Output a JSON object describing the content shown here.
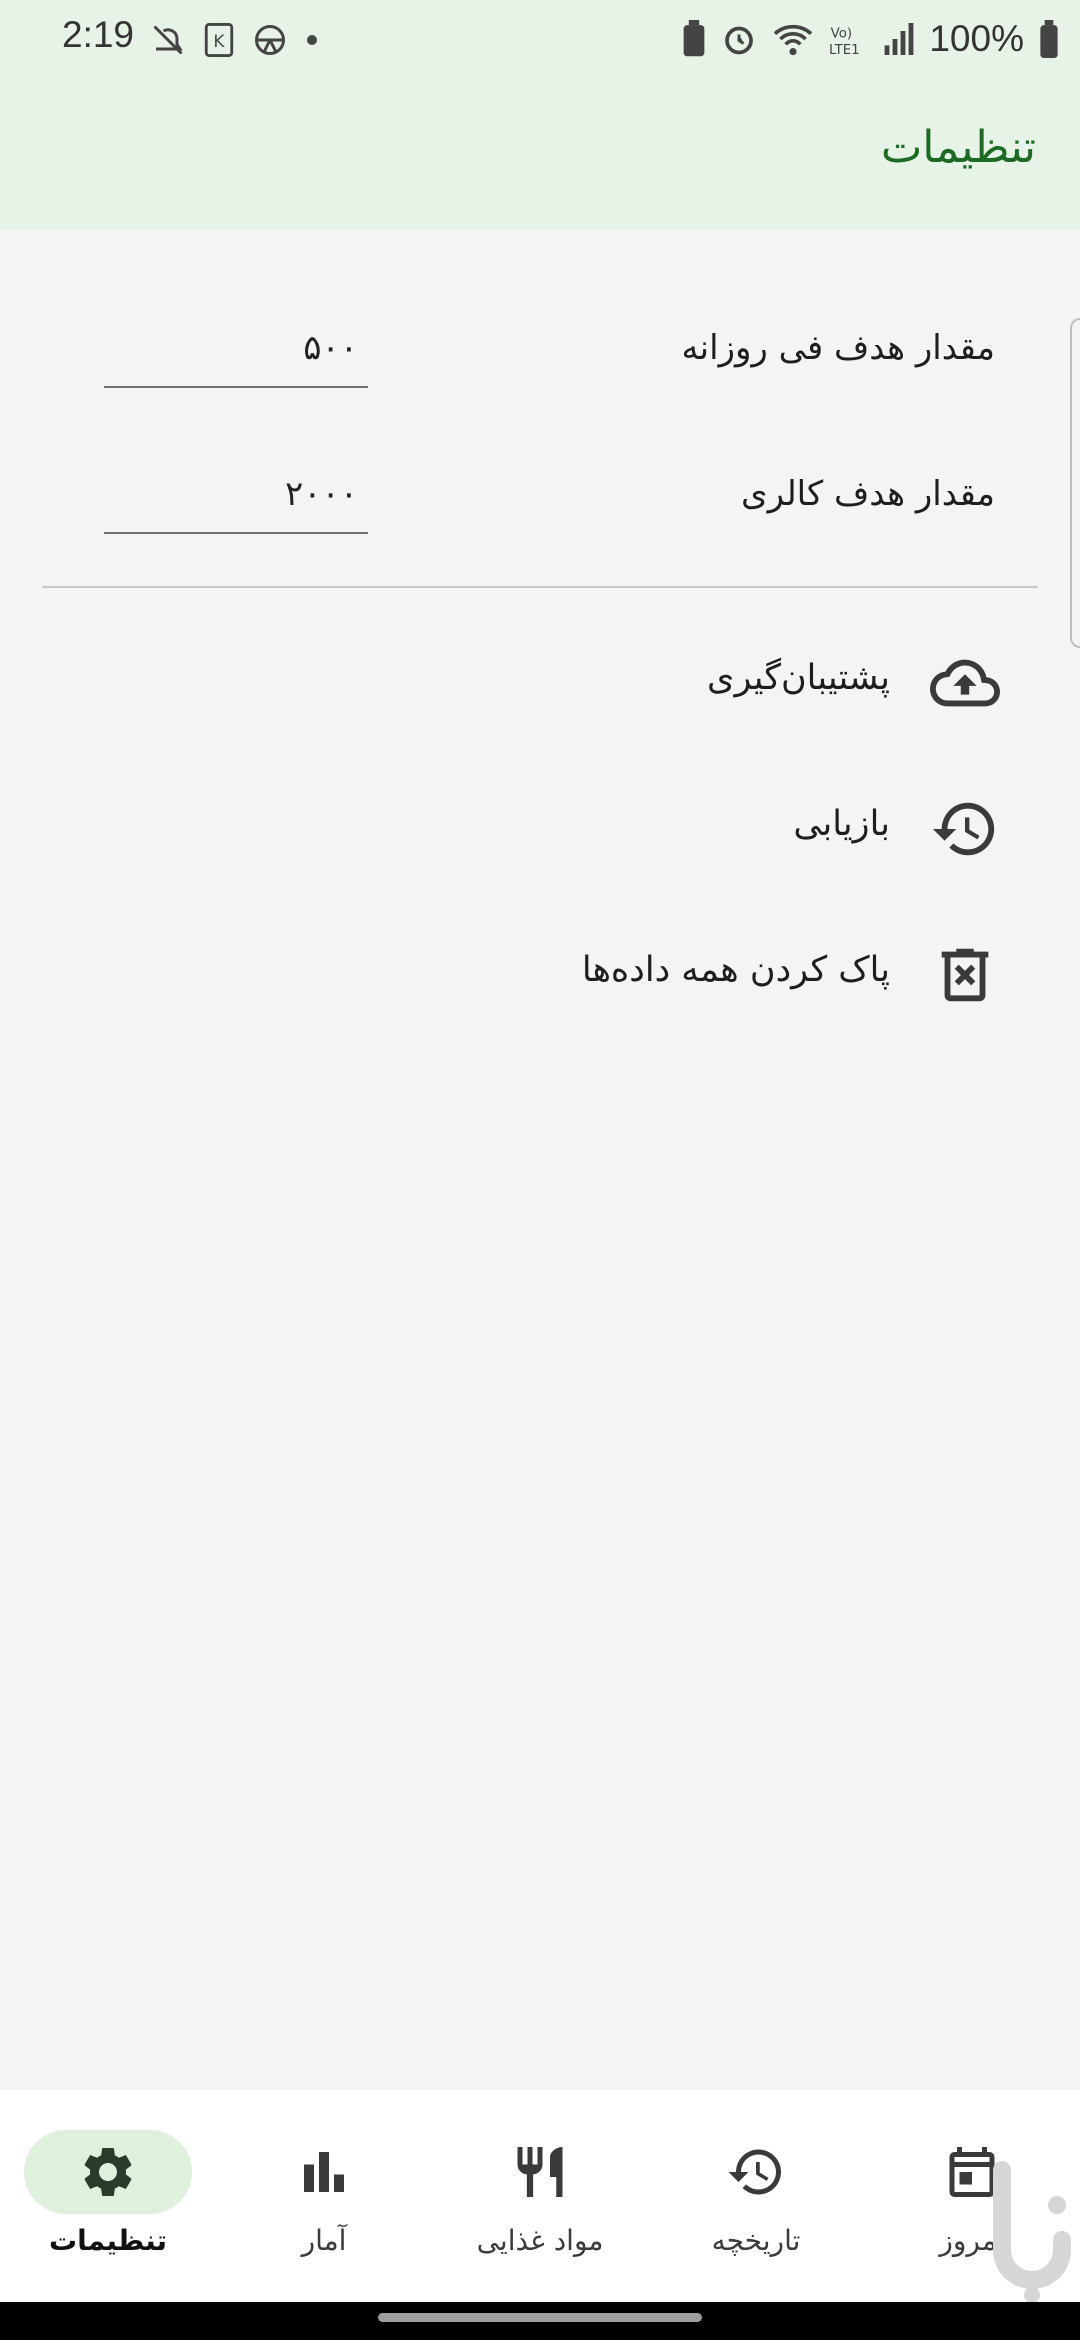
{
  "status_bar": {
    "time": "2:19",
    "battery_text": "100%",
    "left_icons": [
      "notifications-off-icon",
      "k-app-icon",
      "steering-icon",
      "dot-icon"
    ],
    "right_icons": [
      "battery-saver-icon",
      "alarm-icon",
      "wifi-icon",
      "volte-icon",
      "signal-icon",
      "battery-icon"
    ]
  },
  "app_bar": {
    "title": "تنظیمات"
  },
  "settings": {
    "fields": [
      {
        "label": "مقدار هدف فی روزانه",
        "value": "۵۰۰"
      },
      {
        "label": "مقدار هدف کالری",
        "value": "۲۰۰۰"
      }
    ],
    "actions": [
      {
        "label": "پشتیبان‌گیری",
        "icon": "cloud-upload-icon"
      },
      {
        "label": "بازیابی",
        "icon": "restore-history-icon"
      },
      {
        "label": "پاک کردن همه داده‌ها",
        "icon": "delete-icon"
      }
    ]
  },
  "bottom_nav": {
    "items": [
      {
        "label": "امروز",
        "icon": "calendar-icon",
        "active": false
      },
      {
        "label": "تاریخچه",
        "icon": "history-icon",
        "active": false
      },
      {
        "label": "مواد غذایی",
        "icon": "restaurant-icon",
        "active": false
      },
      {
        "label": "آمار",
        "icon": "bar-chart-icon",
        "active": false
      },
      {
        "label": "تنظیمات",
        "icon": "settings-gear-icon",
        "active": true
      }
    ]
  },
  "colors": {
    "accent": "#1d6a24",
    "app_bar_bg": "#e7f3e6",
    "active_pill": "#dff0dd"
  }
}
